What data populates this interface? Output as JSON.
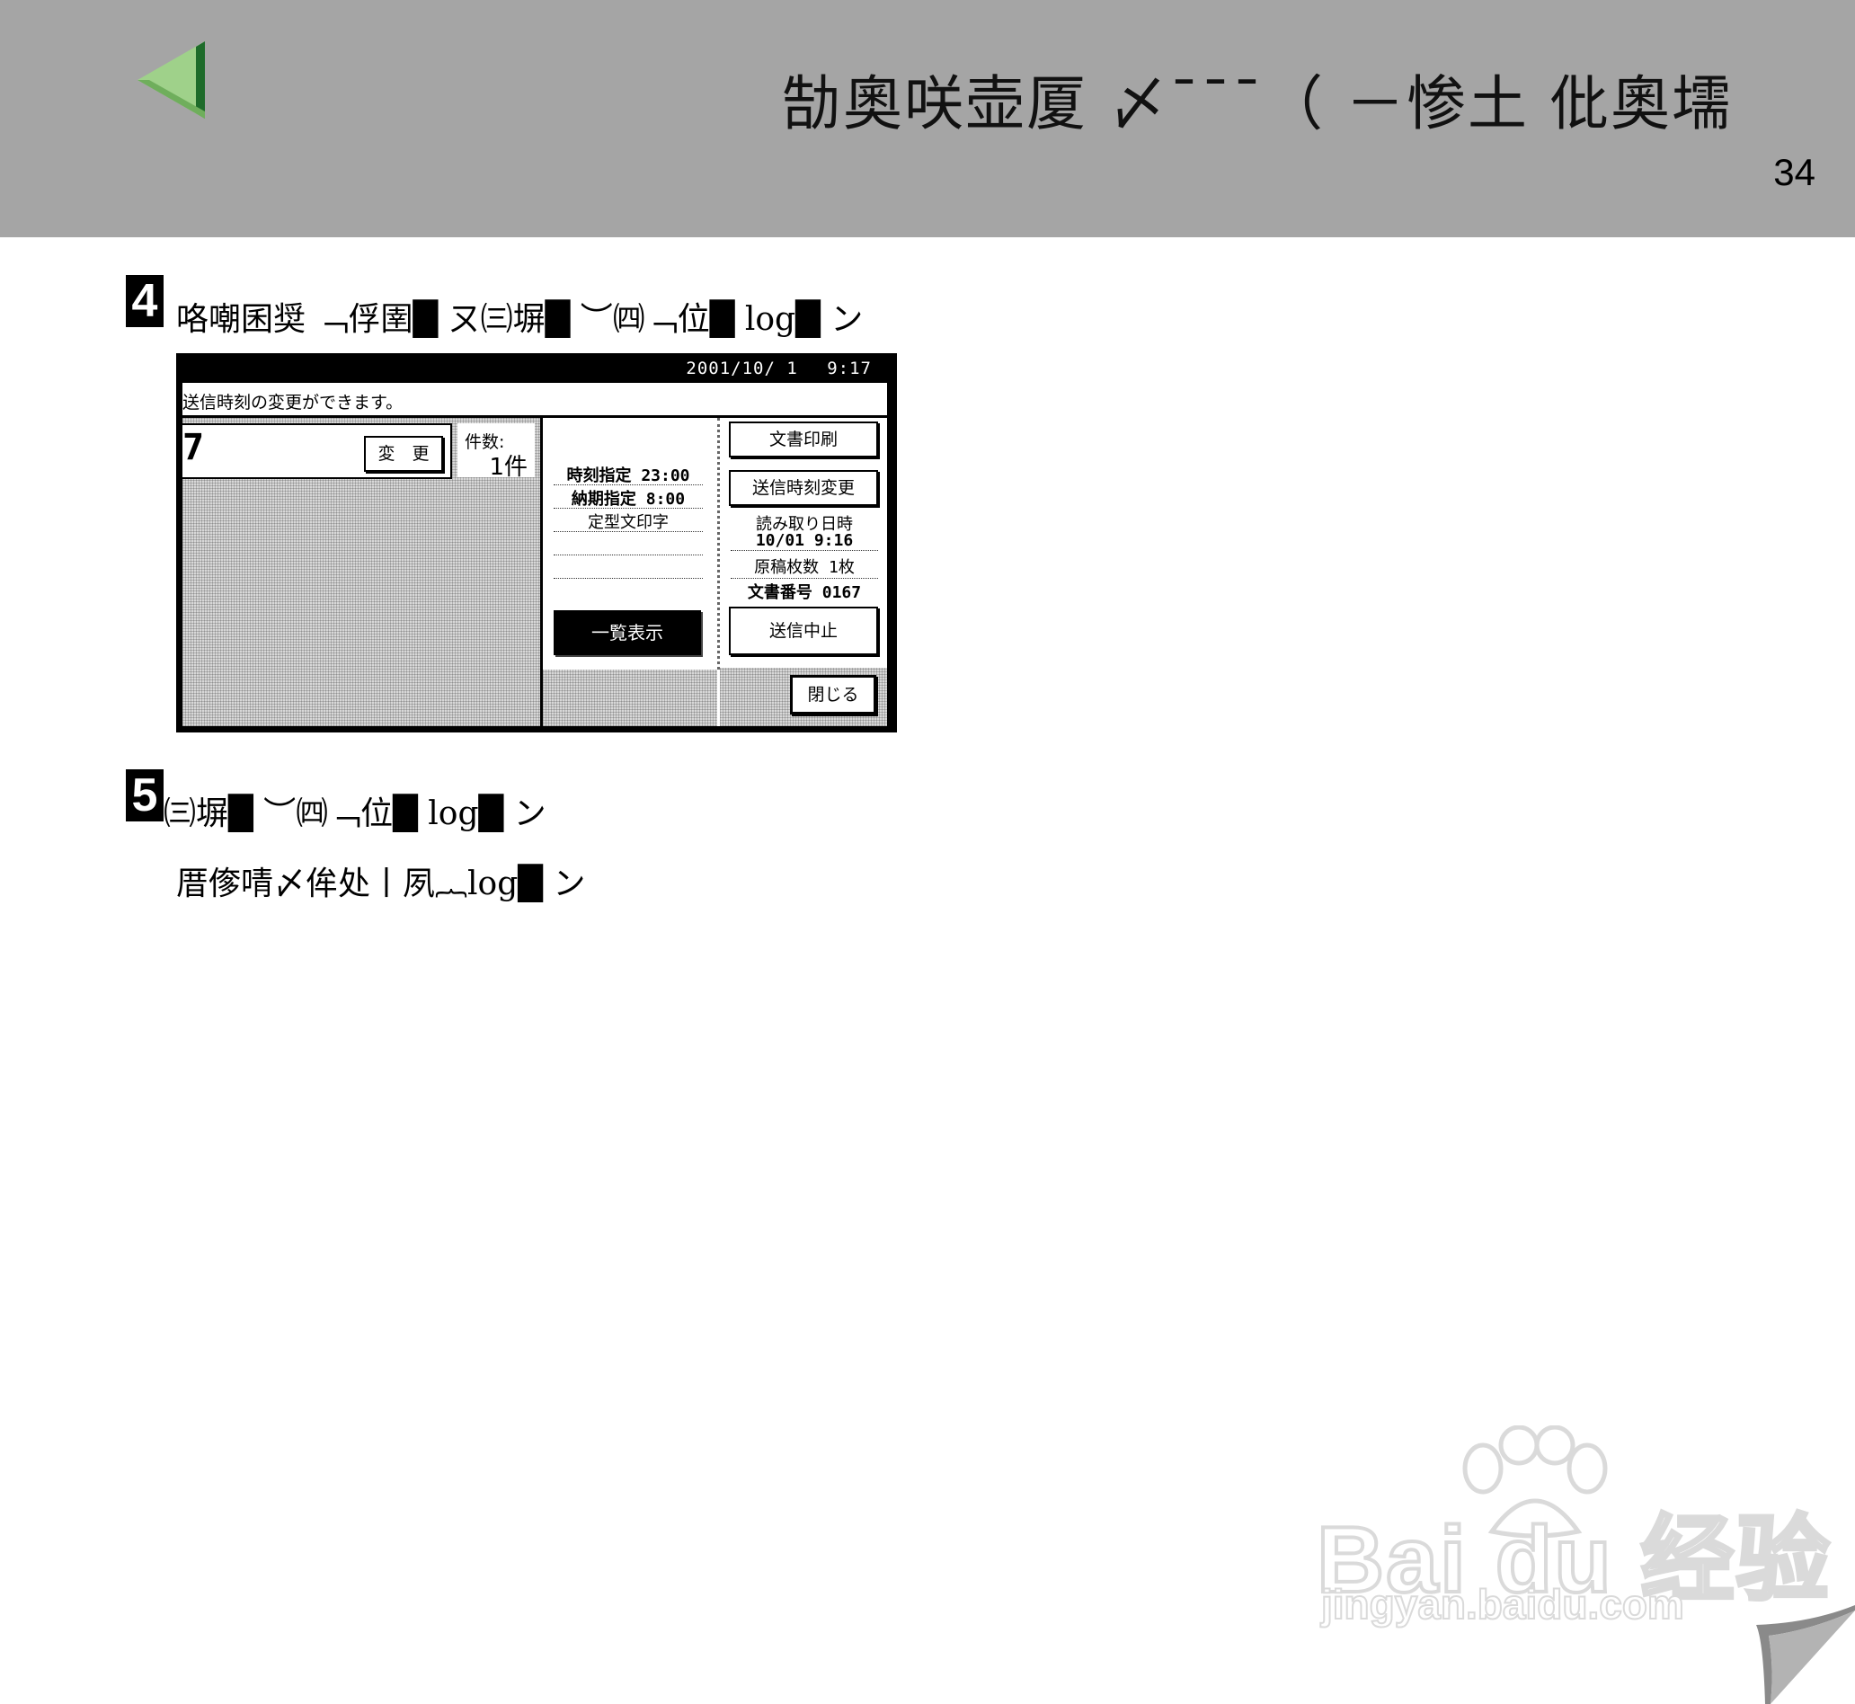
{
  "header": {
    "title": "勂奧咲壶厦 〆¯¯¯（ －惨土 仳奧壖",
    "page_number": "34",
    "back_icon": "green-left-triangle-icon",
    "background": "#a5a5a5"
  },
  "steps": [
    {
      "number": "4",
      "text": "咯嘲囷奨 ﹁俘圉█ ㄡ㈢塀█ ︶㈣﹁位█ log█ ン"
    },
    {
      "number": "5",
      "text": "㈢塀█ ︶㈣﹁位█ log█ ン",
      "subtext": "厝偧啨〆侔处丨夙︷log█ ン"
    }
  ],
  "device": {
    "datetime": "2001/10/ 1　 9:17",
    "message": "送信時刻の変更ができます。",
    "number_display": "7",
    "change_button": "変　更",
    "count_label": "件数:",
    "count_value": "1件",
    "schedule_rows": [
      "時刻指定 23:00",
      "納期指定  8:00",
      "定型文印字"
    ],
    "list_button": "一覧表示",
    "print_button": "文書印刷",
    "change_time_button": "送信時刻変更",
    "scan_label": "読み取り日時",
    "scan_value": "10/01  9:16",
    "pages_row": "原稿枚数   1枚",
    "docno_row": "文書番号  0167",
    "cancel_button": "送信中止",
    "close_button": "閉じる"
  },
  "watermark": {
    "logo_text": "Bai du 经验",
    "url_text": "jingyan.baidu.com"
  }
}
